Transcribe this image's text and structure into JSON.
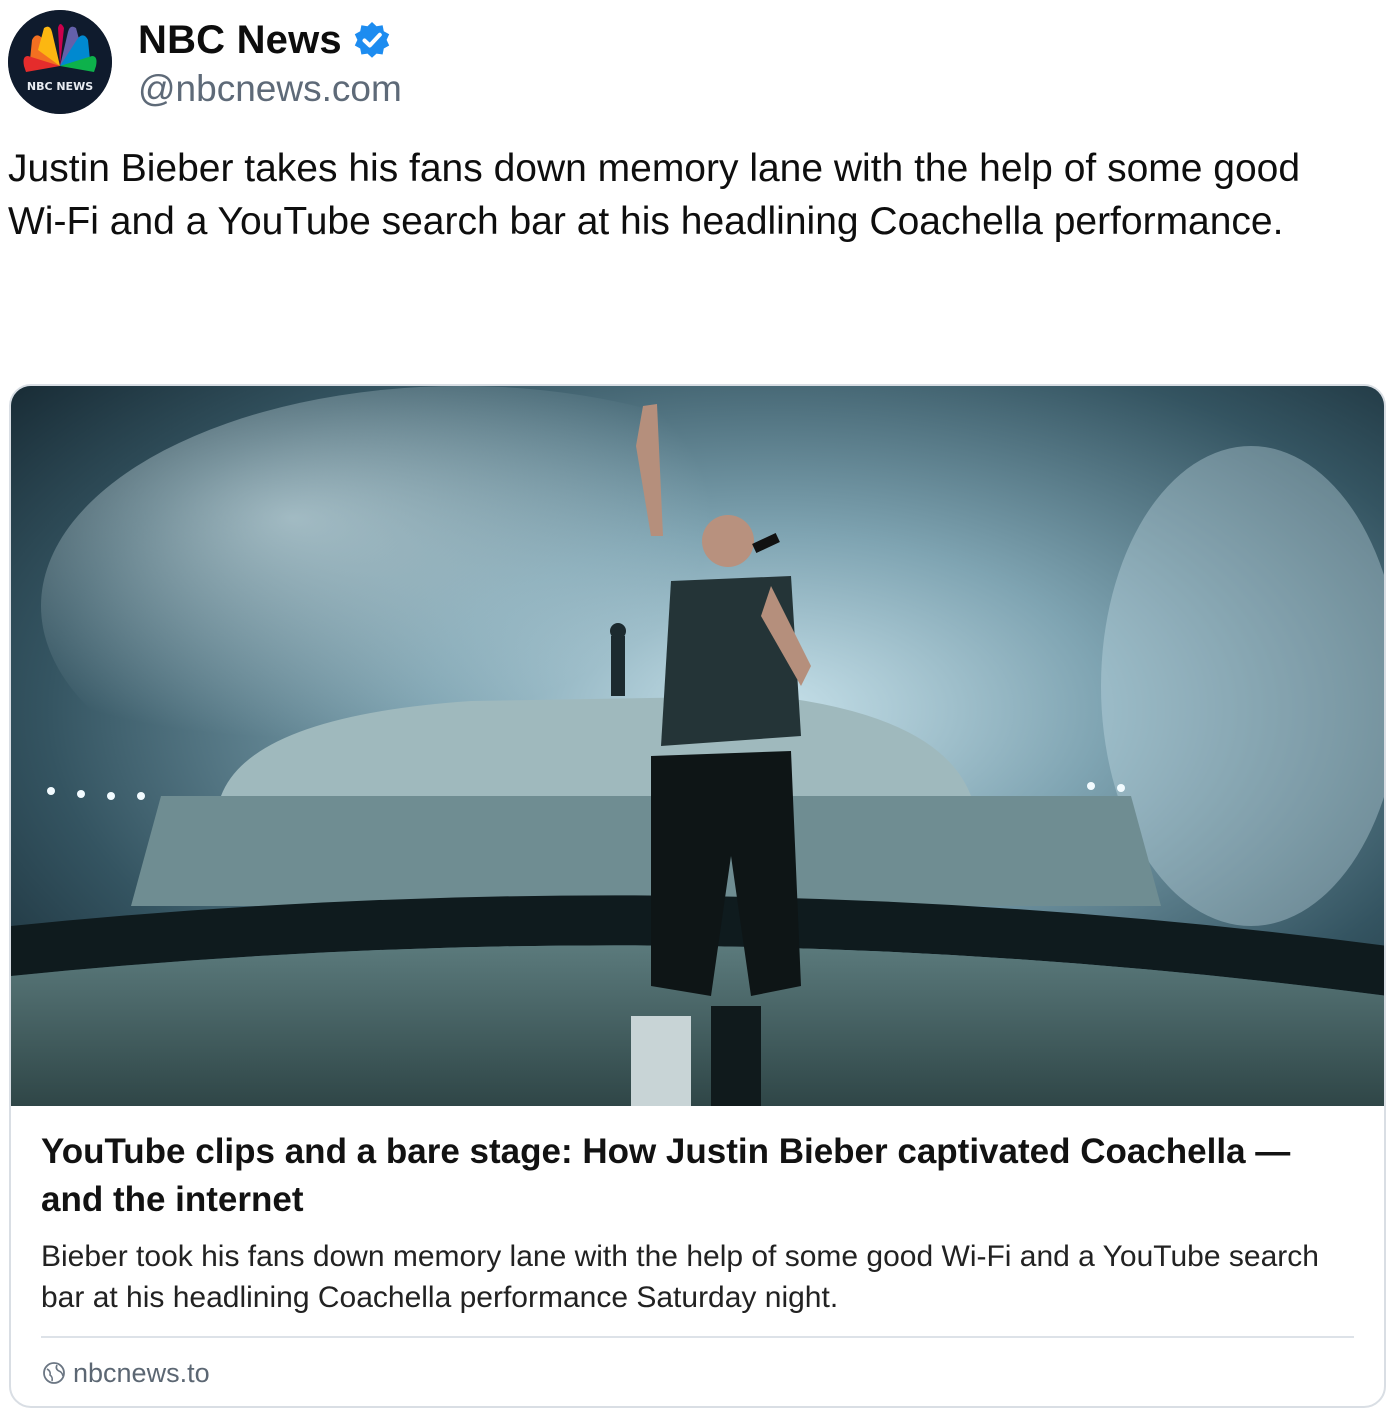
{
  "author": {
    "display_name": "NBC News",
    "handle": "@nbcnews.com",
    "avatar_icon": "nbc-peacock-logo",
    "avatar_text": "NBC NEWS",
    "verified_icon": "verified-check-icon",
    "verified_color": "#1d8cf0"
  },
  "post": {
    "text": "Justin Bieber takes his fans down memory lane with the help of some good Wi-Fi and a YouTube search bar at his headlining Coachella performance."
  },
  "link_card": {
    "image_alt": "Justin Bieber performing on a bare stage at Coachella",
    "title": "YouTube clips and a bare stage: How Justin Bieber captivated Coachella — and the internet",
    "description": "Bieber took his fans down memory lane with the help of some good Wi-Fi and a YouTube search bar at his headlining Coachella performance Saturday night.",
    "domain": "nbcnews.to",
    "domain_icon": "globe-icon"
  }
}
